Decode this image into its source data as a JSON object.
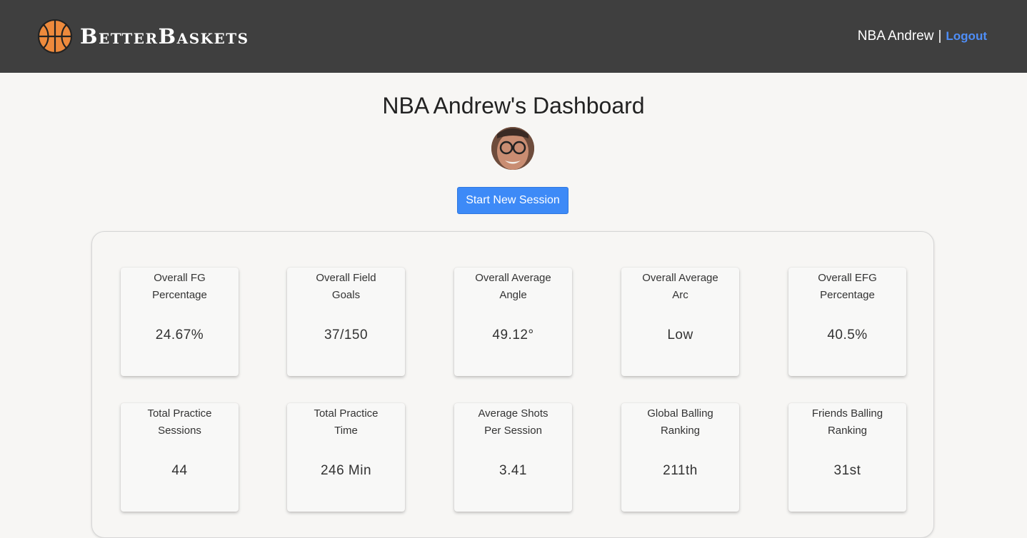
{
  "brand": {
    "name": "BetterBaskets"
  },
  "header": {
    "user_name": "NBA Andrew",
    "separator": "|",
    "logout_label": "Logout"
  },
  "main": {
    "title": "NBA Andrew's Dashboard",
    "start_button_label": "Start New Session"
  },
  "stats": [
    {
      "label": "Overall FG Percentage",
      "value": "24.67%"
    },
    {
      "label": "Overall Field Goals",
      "value": "37/150"
    },
    {
      "label": "Overall Average Angle",
      "value": "49.12°"
    },
    {
      "label": "Overall Average Arc",
      "value": "Low"
    },
    {
      "label": "Overall EFG Percentage",
      "value": "40.5%"
    },
    {
      "label": "Total Practice Sessions",
      "value": "44"
    },
    {
      "label": "Total Practice Time",
      "value": "246 Min"
    },
    {
      "label": "Average Shots Per Session",
      "value": "3.41"
    },
    {
      "label": "Global Balling Ranking",
      "value": "211th"
    },
    {
      "label": "Friends Balling Ranking",
      "value": "31st"
    }
  ],
  "colors": {
    "navbar": "#3f3f3f",
    "accent": "#3d8af7",
    "logout_link": "#4f8ef7",
    "ball": "#ee8a3c"
  }
}
